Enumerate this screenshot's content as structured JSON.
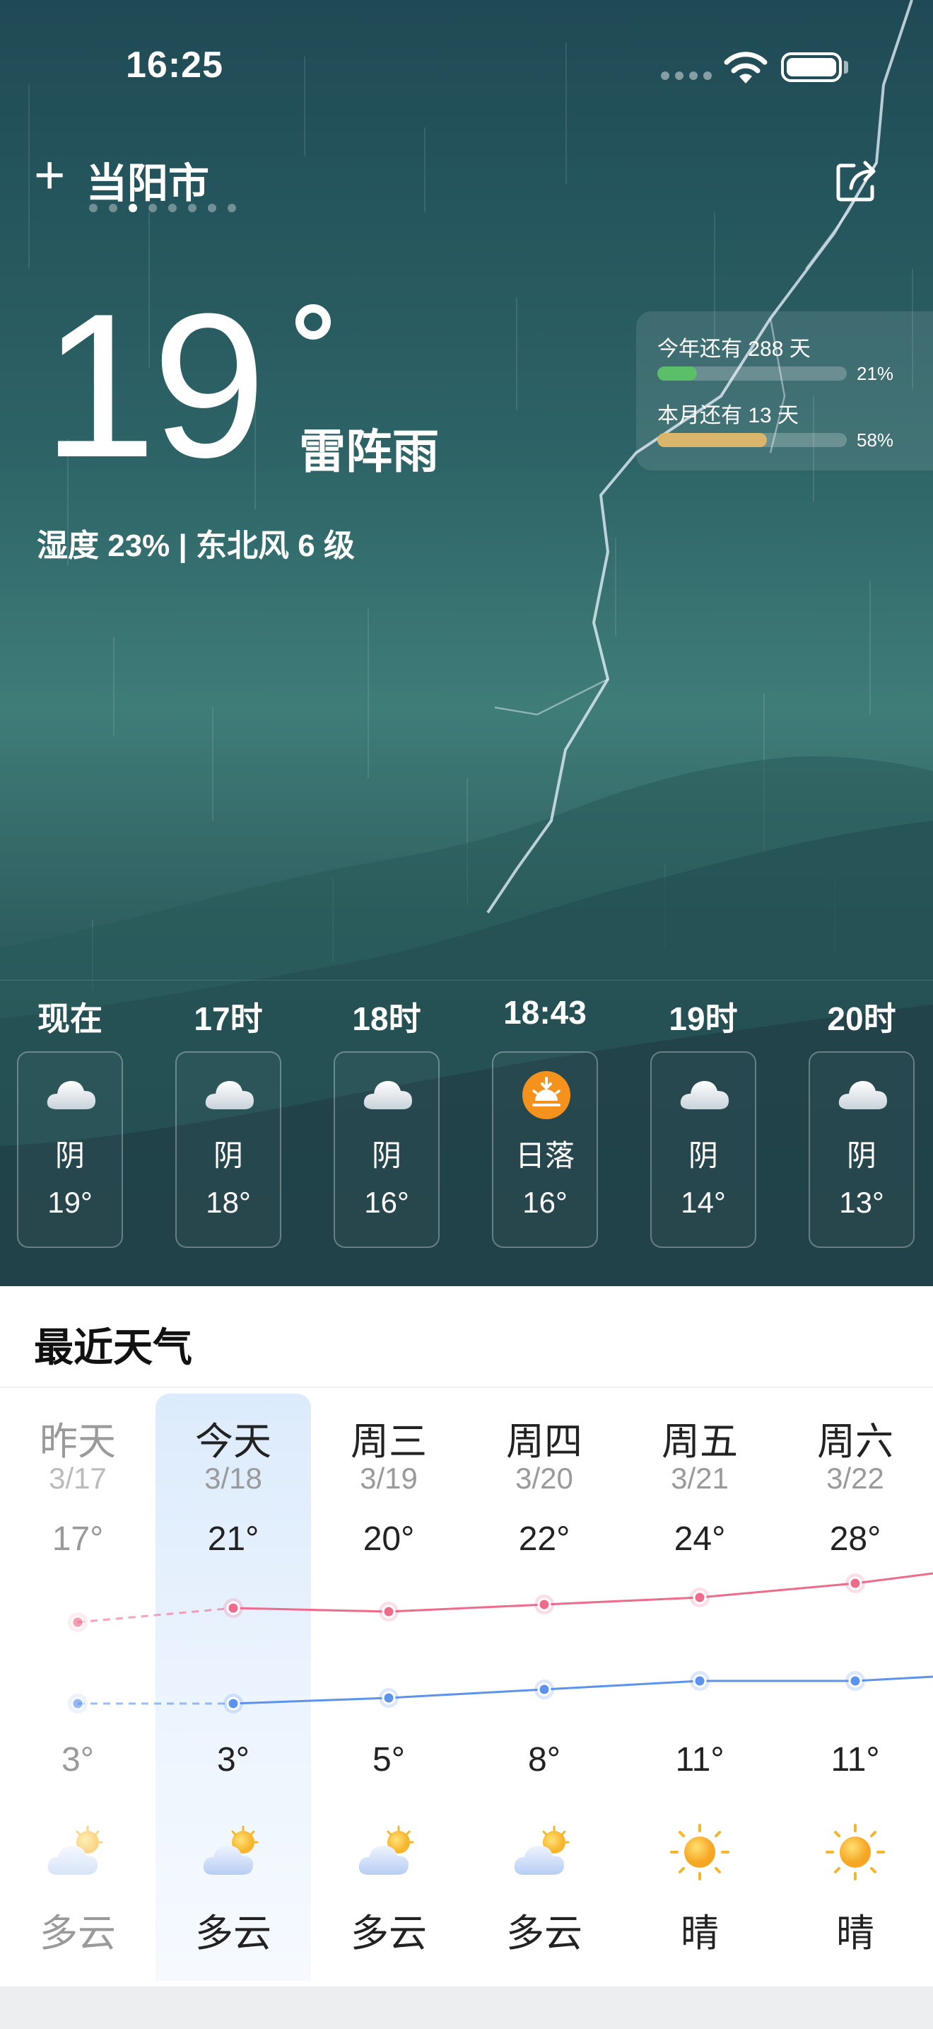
{
  "status_bar": {
    "time": "16:25"
  },
  "header": {
    "add_icon": "plus-icon",
    "city": "当阳市",
    "page_count": 8,
    "active_page": 3,
    "share_icon": "share-icon"
  },
  "current": {
    "temperature": "19",
    "condition": "雷阵雨",
    "details": "湿度 23% | 东北风 6 级"
  },
  "progress": [
    {
      "label": "今年还有 288 天",
      "percent_text": "21%",
      "percent": 0.21,
      "color": "#5bbf6a"
    },
    {
      "label": "本月还有 13 天",
      "percent_text": "58%",
      "percent": 0.58,
      "color": "#d9b66a"
    }
  ],
  "hourly": [
    {
      "time": "现在",
      "icon": "cloud-icon",
      "condition": "阴",
      "temp": "19°"
    },
    {
      "time": "17时",
      "icon": "cloud-icon",
      "condition": "阴",
      "temp": "18°"
    },
    {
      "time": "18时",
      "icon": "cloud-icon",
      "condition": "阴",
      "temp": "16°"
    },
    {
      "time": "18:43",
      "icon": "sunset-icon",
      "condition": "日落",
      "temp": "16°"
    },
    {
      "time": "19时",
      "icon": "cloud-icon",
      "condition": "阴",
      "temp": "14°"
    },
    {
      "time": "20时",
      "icon": "cloud-icon",
      "condition": "阴",
      "temp": "13°"
    }
  ],
  "daily": {
    "title": "最近天气",
    "days": [
      {
        "name": "昨天",
        "date": "3/17",
        "high": "17°",
        "low": "3°",
        "icon": "partly-cloudy-icon",
        "condition": "多云",
        "past": true
      },
      {
        "name": "今天",
        "date": "3/18",
        "high": "21°",
        "low": "3°",
        "icon": "partly-cloudy-icon",
        "condition": "多云",
        "today": true
      },
      {
        "name": "周三",
        "date": "3/19",
        "high": "20°",
        "low": "5°",
        "icon": "partly-cloudy-icon",
        "condition": "多云"
      },
      {
        "name": "周四",
        "date": "3/20",
        "high": "22°",
        "low": "8°",
        "icon": "partly-cloudy-icon",
        "condition": "多云"
      },
      {
        "name": "周五",
        "date": "3/21",
        "high": "24°",
        "low": "11°",
        "icon": "sun-icon",
        "condition": "晴"
      },
      {
        "name": "周六",
        "date": "3/22",
        "high": "28°",
        "low": "11°",
        "icon": "sun-icon",
        "condition": "晴"
      }
    ]
  },
  "colors": {
    "high_line": "#ef6b8c",
    "low_line": "#5b93ee",
    "sunset": "#f5921e"
  }
}
